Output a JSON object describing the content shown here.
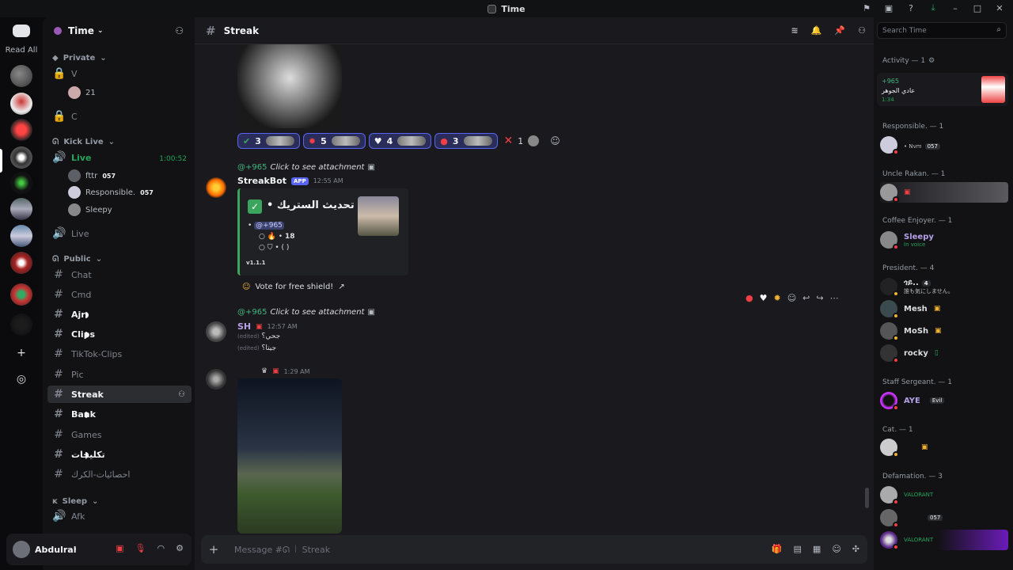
{
  "window": {
    "title": "Time"
  },
  "rail": {
    "read_all": "Read All"
  },
  "server": {
    "name": "Time"
  },
  "sidebar": {
    "cat_private": "Private",
    "ch_v": "V",
    "v_member": "21",
    "ch_c": "C",
    "cat_kick": "Kick Live",
    "ch_live": "Live",
    "live_time": "1:00:52",
    "vm1": "fttr",
    "vm1_tag": "057",
    "vm2": "Responsible.",
    "vm2_tag": "057",
    "vm3": "Sleepy",
    "ch_live2": "Live",
    "cat_public": "Public",
    "channels": [
      "Chat",
      "Cmd",
      "Ajr",
      "Clips",
      "TikTok-Clips",
      "Pic",
      "Streak",
      "Bank",
      "Games",
      "تكليجات",
      "احصائيات-الكرك"
    ],
    "cat_sleep": "Sleep",
    "ch_afk": "Afk"
  },
  "user": {
    "name": "Abdulrah..."
  },
  "channel": {
    "name": "Streak",
    "placeholder": "Message #ᘏ ꒐ Streak"
  },
  "reactions": [
    {
      "icon": "✔",
      "count": "3"
    },
    {
      "icon": "✹",
      "count": "5"
    },
    {
      "icon": "♥",
      "count": "4"
    },
    {
      "icon": "●",
      "count": "3"
    }
  ],
  "react_x": "1",
  "msg1": {
    "reply_user": "@+965",
    "reply_text": "Click to see attachment",
    "author": "StreakBot",
    "app": "APP",
    "time": "12:55 AM",
    "embed_title": "تم تحديث الستريك •",
    "mention": "@+965",
    "streak": "18",
    "shield": "• (                   )",
    "version": "v1.1.1",
    "button": "Vote for free shield!"
  },
  "msg2": {
    "reply_user": "@+965",
    "reply_text": "Click to see attachment",
    "author": "SH",
    "time": "12:57 AM",
    "line1": "جحي؟",
    "line1_edit": "(edited)",
    "line2": "جيتا؟",
    "line2_edit": "(edited)"
  },
  "msg3": {
    "time": "1:29 AM"
  },
  "members": {
    "search_placeholder": "Search Time",
    "activity_hdr": "Activity — 1",
    "activity": {
      "user": "+965",
      "title": "عادي الجوهر",
      "time": "1:34"
    },
    "groups": [
      {
        "title": "Responsible. — 1"
      },
      {
        "title": "Uncle Rakan. — 1"
      },
      {
        "title": "Coffee Enjoyer. — 1"
      },
      {
        "title": "President. — 4"
      },
      {
        "title": "Staff Sergeant. — 1"
      },
      {
        "title": "Cat. — 1"
      },
      {
        "title": "Defamation. — 3"
      }
    ],
    "m_resp": "• Nvm",
    "m_resp_tag": "057",
    "m_sleepy": "Sleepy",
    "m_sleepy_sub": "In voice",
    "m_p1": "ጎይ..",
    "m_p1_tag": "4",
    "m_p1_sub": "誰も気にしません。",
    "m_p2": "Mesh",
    "m_p3": "MoSh",
    "m_p4": "rocky",
    "m_aye": "AYE",
    "m_aye_tag": "Evil",
    "m_d1_sub": "VALORANT",
    "m_d2_tag": "057",
    "m_d3_sub": "VALORANT"
  }
}
